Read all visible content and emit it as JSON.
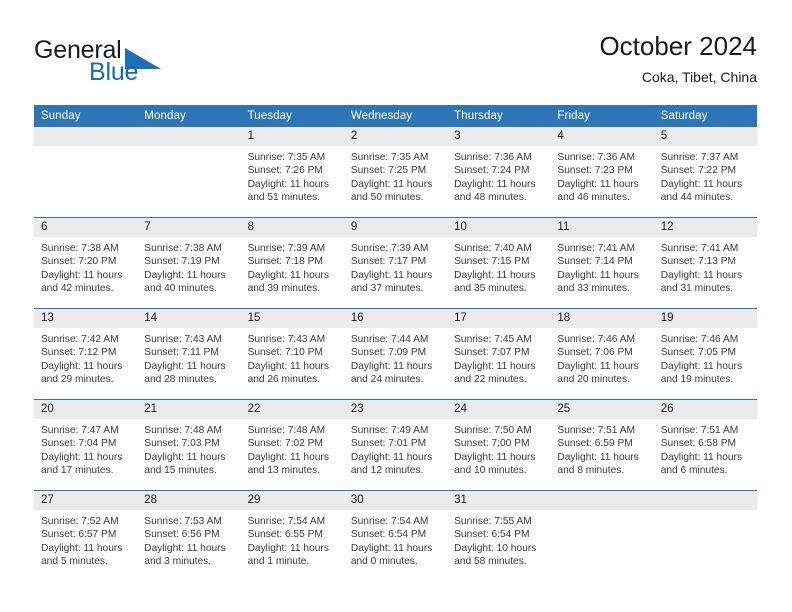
{
  "brand": {
    "word1": "General",
    "word2": "Blue",
    "flag_icon": "triangle-flag-icon",
    "accent_color": "#1469b4"
  },
  "header": {
    "title": "October 2024",
    "subtitle": "Coka, Tibet, China"
  },
  "calendar": {
    "header_color": "#2e75b6",
    "daynum_band_color": "#ebebeb",
    "weekdays": [
      "Sunday",
      "Monday",
      "Tuesday",
      "Wednesday",
      "Thursday",
      "Friday",
      "Saturday"
    ],
    "weeks": [
      [
        {
          "day": "",
          "empty": true
        },
        {
          "day": "",
          "empty": true
        },
        {
          "day": "1",
          "sunrise": "Sunrise: 7:35 AM",
          "sunset": "Sunset: 7:26 PM",
          "daylight": "Daylight: 11 hours and 51 minutes."
        },
        {
          "day": "2",
          "sunrise": "Sunrise: 7:35 AM",
          "sunset": "Sunset: 7:25 PM",
          "daylight": "Daylight: 11 hours and 50 minutes."
        },
        {
          "day": "3",
          "sunrise": "Sunrise: 7:36 AM",
          "sunset": "Sunset: 7:24 PM",
          "daylight": "Daylight: 11 hours and 48 minutes."
        },
        {
          "day": "4",
          "sunrise": "Sunrise: 7:36 AM",
          "sunset": "Sunset: 7:23 PM",
          "daylight": "Daylight: 11 hours and 46 minutes."
        },
        {
          "day": "5",
          "sunrise": "Sunrise: 7:37 AM",
          "sunset": "Sunset: 7:22 PM",
          "daylight": "Daylight: 11 hours and 44 minutes."
        }
      ],
      [
        {
          "day": "6",
          "sunrise": "Sunrise: 7:38 AM",
          "sunset": "Sunset: 7:20 PM",
          "daylight": "Daylight: 11 hours and 42 minutes."
        },
        {
          "day": "7",
          "sunrise": "Sunrise: 7:38 AM",
          "sunset": "Sunset: 7:19 PM",
          "daylight": "Daylight: 11 hours and 40 minutes."
        },
        {
          "day": "8",
          "sunrise": "Sunrise: 7:39 AM",
          "sunset": "Sunset: 7:18 PM",
          "daylight": "Daylight: 11 hours and 39 minutes."
        },
        {
          "day": "9",
          "sunrise": "Sunrise: 7:39 AM",
          "sunset": "Sunset: 7:17 PM",
          "daylight": "Daylight: 11 hours and 37 minutes."
        },
        {
          "day": "10",
          "sunrise": "Sunrise: 7:40 AM",
          "sunset": "Sunset: 7:15 PM",
          "daylight": "Daylight: 11 hours and 35 minutes."
        },
        {
          "day": "11",
          "sunrise": "Sunrise: 7:41 AM",
          "sunset": "Sunset: 7:14 PM",
          "daylight": "Daylight: 11 hours and 33 minutes."
        },
        {
          "day": "12",
          "sunrise": "Sunrise: 7:41 AM",
          "sunset": "Sunset: 7:13 PM",
          "daylight": "Daylight: 11 hours and 31 minutes."
        }
      ],
      [
        {
          "day": "13",
          "sunrise": "Sunrise: 7:42 AM",
          "sunset": "Sunset: 7:12 PM",
          "daylight": "Daylight: 11 hours and 29 minutes."
        },
        {
          "day": "14",
          "sunrise": "Sunrise: 7:43 AM",
          "sunset": "Sunset: 7:11 PM",
          "daylight": "Daylight: 11 hours and 28 minutes."
        },
        {
          "day": "15",
          "sunrise": "Sunrise: 7:43 AM",
          "sunset": "Sunset: 7:10 PM",
          "daylight": "Daylight: 11 hours and 26 minutes."
        },
        {
          "day": "16",
          "sunrise": "Sunrise: 7:44 AM",
          "sunset": "Sunset: 7:09 PM",
          "daylight": "Daylight: 11 hours and 24 minutes."
        },
        {
          "day": "17",
          "sunrise": "Sunrise: 7:45 AM",
          "sunset": "Sunset: 7:07 PM",
          "daylight": "Daylight: 11 hours and 22 minutes."
        },
        {
          "day": "18",
          "sunrise": "Sunrise: 7:46 AM",
          "sunset": "Sunset: 7:06 PM",
          "daylight": "Daylight: 11 hours and 20 minutes."
        },
        {
          "day": "19",
          "sunrise": "Sunrise: 7:46 AM",
          "sunset": "Sunset: 7:05 PM",
          "daylight": "Daylight: 11 hours and 19 minutes."
        }
      ],
      [
        {
          "day": "20",
          "sunrise": "Sunrise: 7:47 AM",
          "sunset": "Sunset: 7:04 PM",
          "daylight": "Daylight: 11 hours and 17 minutes."
        },
        {
          "day": "21",
          "sunrise": "Sunrise: 7:48 AM",
          "sunset": "Sunset: 7:03 PM",
          "daylight": "Daylight: 11 hours and 15 minutes."
        },
        {
          "day": "22",
          "sunrise": "Sunrise: 7:48 AM",
          "sunset": "Sunset: 7:02 PM",
          "daylight": "Daylight: 11 hours and 13 minutes."
        },
        {
          "day": "23",
          "sunrise": "Sunrise: 7:49 AM",
          "sunset": "Sunset: 7:01 PM",
          "daylight": "Daylight: 11 hours and 12 minutes."
        },
        {
          "day": "24",
          "sunrise": "Sunrise: 7:50 AM",
          "sunset": "Sunset: 7:00 PM",
          "daylight": "Daylight: 11 hours and 10 minutes."
        },
        {
          "day": "25",
          "sunrise": "Sunrise: 7:51 AM",
          "sunset": "Sunset: 6:59 PM",
          "daylight": "Daylight: 11 hours and 8 minutes."
        },
        {
          "day": "26",
          "sunrise": "Sunrise: 7:51 AM",
          "sunset": "Sunset: 6:58 PM",
          "daylight": "Daylight: 11 hours and 6 minutes."
        }
      ],
      [
        {
          "day": "27",
          "sunrise": "Sunrise: 7:52 AM",
          "sunset": "Sunset: 6:57 PM",
          "daylight": "Daylight: 11 hours and 5 minutes."
        },
        {
          "day": "28",
          "sunrise": "Sunrise: 7:53 AM",
          "sunset": "Sunset: 6:56 PM",
          "daylight": "Daylight: 11 hours and 3 minutes."
        },
        {
          "day": "29",
          "sunrise": "Sunrise: 7:54 AM",
          "sunset": "Sunset: 6:55 PM",
          "daylight": "Daylight: 11 hours and 1 minute."
        },
        {
          "day": "30",
          "sunrise": "Sunrise: 7:54 AM",
          "sunset": "Sunset: 6:54 PM",
          "daylight": "Daylight: 11 hours and 0 minutes."
        },
        {
          "day": "31",
          "sunrise": "Sunrise: 7:55 AM",
          "sunset": "Sunset: 6:54 PM",
          "daylight": "Daylight: 10 hours and 58 minutes."
        },
        {
          "day": "",
          "empty": true
        },
        {
          "day": "",
          "empty": true
        }
      ]
    ]
  }
}
